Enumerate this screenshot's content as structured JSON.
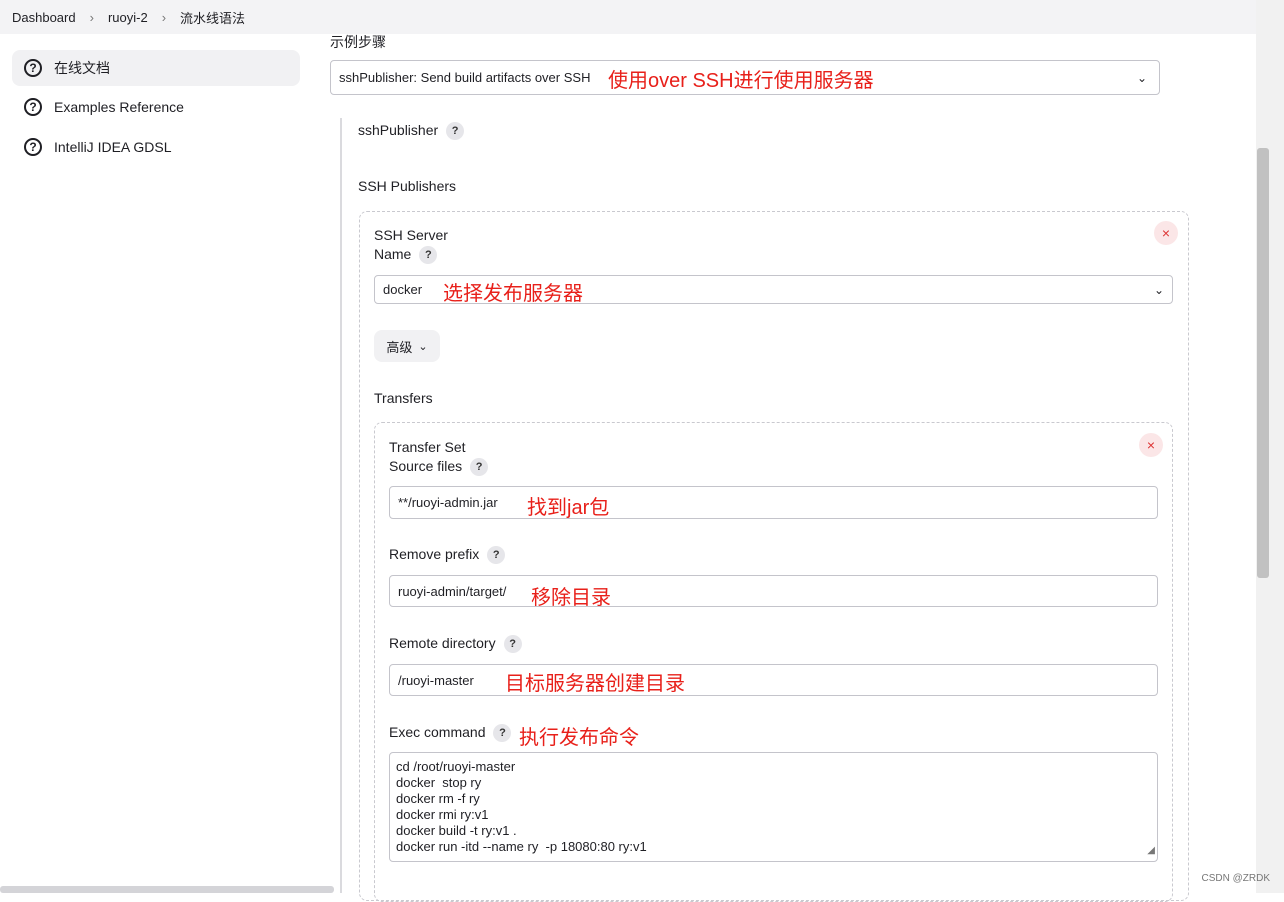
{
  "breadcrumb": [
    "Dashboard",
    "ruoyi-2",
    "流水线语法"
  ],
  "sidebar": {
    "items": [
      {
        "label": "在线文档",
        "icon": "help-circle-icon"
      },
      {
        "label": "Examples Reference",
        "icon": "help-circle-icon"
      },
      {
        "label": "IntelliJ IDEA GDSL",
        "icon": "help-circle-icon"
      }
    ]
  },
  "form": {
    "sample_step_label": "示例步骤",
    "sample_step_value": "sshPublisher: Send build artifacts over SSH",
    "sample_step_note": "使用over SSH进行使用服务器",
    "ssh_publisher_label": "sshPublisher",
    "ssh_publishers_label": "SSH Publishers",
    "ssh_server_title": "SSH Server",
    "name_label": "Name",
    "name_value": "docker",
    "name_note": "选择发布服务器",
    "advanced_label": "高级",
    "transfers_label": "Transfers",
    "transfer_set_title": "Transfer Set",
    "source_files_label": "Source files",
    "source_files_value": "**/ruoyi-admin.jar",
    "source_files_note": "找到jar包",
    "remove_prefix_label": "Remove prefix",
    "remove_prefix_value": "ruoyi-admin/target/",
    "remove_prefix_note": "移除目录",
    "remote_dir_label": "Remote directory",
    "remote_dir_value": "/ruoyi-master",
    "remote_dir_note": "目标服务器创建目录",
    "exec_label": "Exec command",
    "exec_note": "执行发布命令",
    "exec_value": "cd /root/ruoyi-master\ndocker  stop ry\ndocker rm -f ry\ndocker rmi ry:v1\ndocker build -t ry:v1 .\ndocker run -itd --name ry  -p 18080:80 ry:v1"
  },
  "help_glyph": "?",
  "remove_glyph": "×",
  "watermark": "CSDN @ZRDK"
}
